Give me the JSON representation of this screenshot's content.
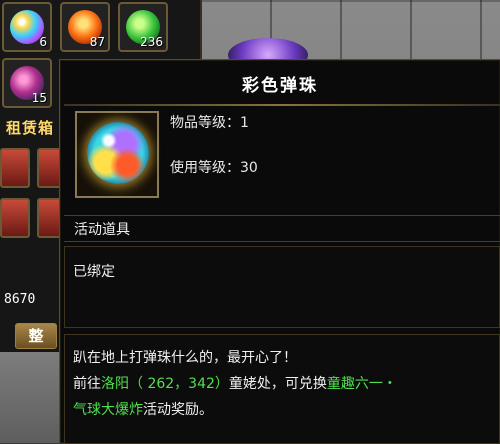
{
  "inventory": {
    "slots": [
      {
        "icon": "rainbow-marble-icon",
        "count": "6"
      },
      {
        "icon": "fire-orb-icon",
        "count": "87"
      },
      {
        "icon": "green-leaf-orb-icon",
        "count": "236"
      },
      {
        "icon": "pink-bubbles-icon",
        "count": "15"
      }
    ],
    "rent_label": "租赁箱",
    "gold": "8670",
    "sort_button": "整"
  },
  "tooltip": {
    "title": "彩色弹珠",
    "item_icon": "rainbow-marble-icon",
    "item_level_label": "物品等级",
    "item_level_value": "1",
    "use_level_label": "使用等级",
    "use_level_value": "30",
    "category": "活动道具",
    "bound_status": "已绑定",
    "description_line1": "趴在地上打弹珠什么的，最开心了！",
    "desc2_prefix": "前往",
    "desc2_place": "洛阳",
    "desc2_coord": "（ 262，342）",
    "desc2_npc": "童姥处，可兑换",
    "desc2_event_a": "童趣六一・",
    "desc3_event_b": "气球大爆炸",
    "desc3_suffix": "活动奖励。"
  },
  "colors": {
    "highlight_green": "#4fe04f",
    "title_white": "#ffffff",
    "border_gold": "#8a7340"
  }
}
